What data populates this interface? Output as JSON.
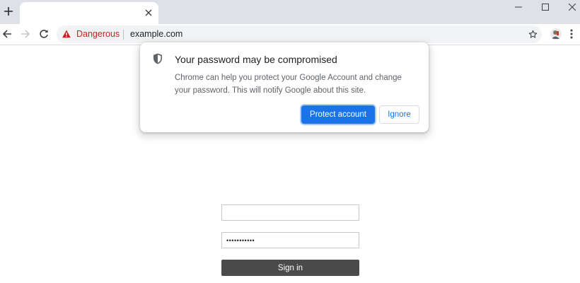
{
  "browser": {
    "new_tab_icon": "plus-icon",
    "window_controls": [
      "minimize-icon",
      "maximize-icon",
      "close-icon"
    ],
    "toolbar": {
      "back_icon": "arrow-left-icon",
      "forward_icon": "arrow-right-icon",
      "reload_icon": "reload-icon",
      "bookmark_icon": "star-icon",
      "menu_icon": "more-vert-icon"
    },
    "omnibox": {
      "security_icon": "warning-triangle-icon",
      "security_label": "Dangerous",
      "security_color": "#c5221f",
      "url": "example.com"
    }
  },
  "bubble": {
    "icon": "shield-icon",
    "title": "Your password may be compromised",
    "body": "Chrome can help you protect your Google Account and change your password. This will notify Google about this site.",
    "primary_button": "Protect account",
    "secondary_button": "Ignore",
    "accent_color": "#1a73e8"
  },
  "page": {
    "username_value": "",
    "password_value": "•••••••••••",
    "signin_label": "Sign in"
  }
}
